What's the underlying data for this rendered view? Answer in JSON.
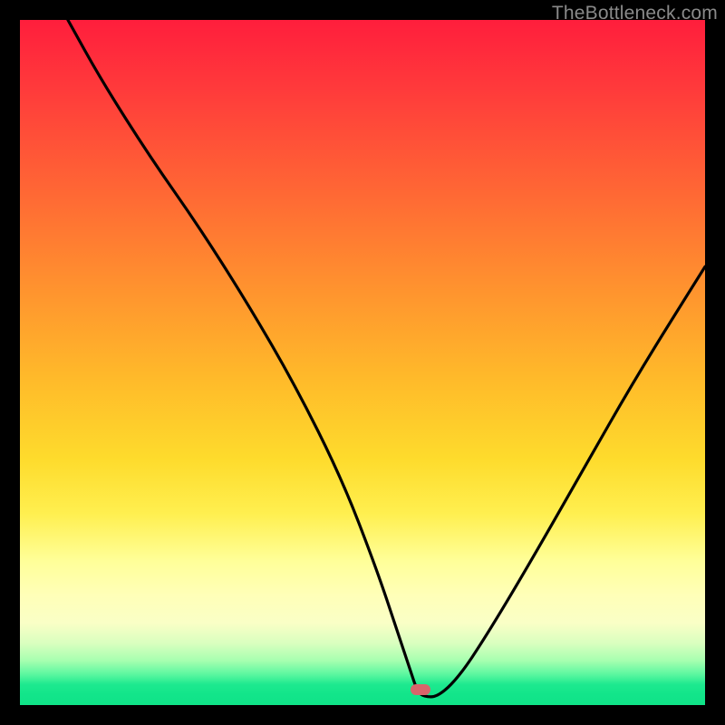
{
  "watermark": "TheBottleneck.com",
  "colors": {
    "frame": "#000000",
    "gradient_top": "#ff1e3c",
    "gradient_mid": "#ffef4f",
    "gradient_bottom": "#10e388",
    "curve": "#000000",
    "marker": "#d9646b",
    "watermark_text": "#8a8a8a"
  },
  "marker": {
    "x_pct": 58.5,
    "y_pct": 97.8
  },
  "chart_data": {
    "type": "line",
    "title": "",
    "xlabel": "",
    "ylabel": "",
    "xlim": [
      0,
      100
    ],
    "ylim": [
      0,
      100
    ],
    "series": [
      {
        "name": "bottleneck-curve",
        "x": [
          7,
          12,
          19,
          26,
          33,
          40,
          47,
          52,
          55,
          57,
          58,
          59,
          61,
          64,
          68,
          74,
          82,
          90,
          100
        ],
        "values": [
          100,
          91,
          80,
          70,
          59,
          47,
          33,
          20,
          11,
          5,
          2,
          1.2,
          1.2,
          4,
          10,
          20,
          34,
          48,
          64
        ]
      }
    ],
    "note": "x is horizontal position as % of inner plot width (left→right); values are height as % of inner plot height (bottom→top). Minimum (≈1.2%) occurs near x≈58–60; curve rises to ≈64% at right edge and starts from top-left at 100%."
  }
}
